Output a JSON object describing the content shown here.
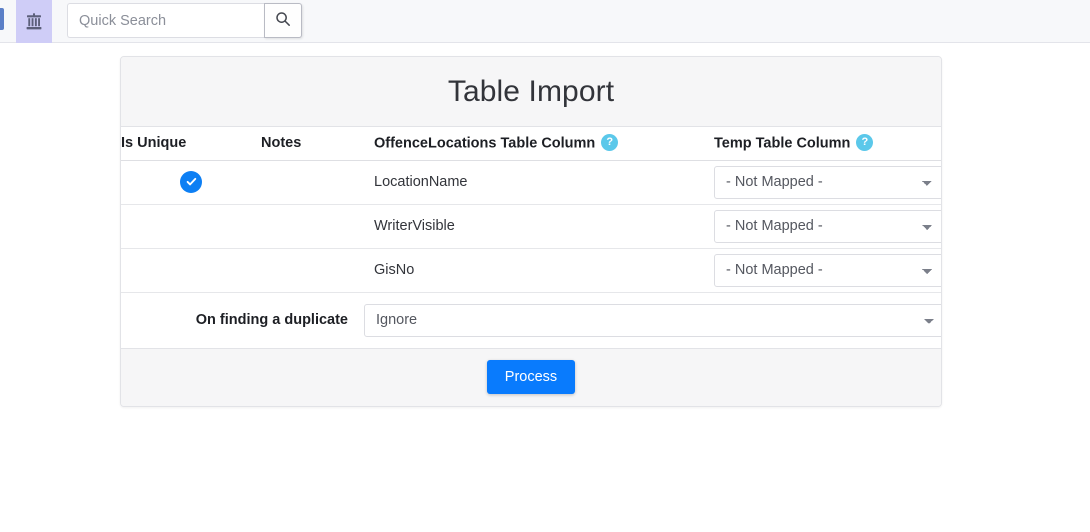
{
  "navbar": {
    "app_icon": "bank-building-icon",
    "search": {
      "placeholder": "Quick Search",
      "value": "",
      "button_icon": "search-icon"
    }
  },
  "card": {
    "title": "Table Import",
    "table": {
      "headers": {
        "is_unique": "Is Unique",
        "notes": "Notes",
        "source_column": "OffenceLocations Table Column",
        "target_column": "Temp Table Column",
        "help_glyph": "?"
      },
      "rows": [
        {
          "is_unique": true,
          "unique_icon": "check-icon",
          "notes": "",
          "source_column": "LocationName",
          "target_select": "- Not Mapped -",
          "target_options": [
            "- Not Mapped -"
          ]
        },
        {
          "is_unique": false,
          "unique_icon": "",
          "notes": "",
          "source_column": "WriterVisible",
          "target_select": "- Not Mapped -",
          "target_options": [
            "- Not Mapped -"
          ]
        },
        {
          "is_unique": false,
          "unique_icon": "",
          "notes": "",
          "source_column": "GisNo",
          "target_select": "- Not Mapped -",
          "target_options": [
            "- Not Mapped -"
          ]
        }
      ],
      "duplicate_row": {
        "label": "On finding a duplicate",
        "value": "Ignore",
        "options": [
          "Ignore"
        ]
      }
    },
    "footer": {
      "process_label": "Process"
    }
  },
  "colors": {
    "accent_blue": "#097bfd",
    "help_badge": "#5bc8ea",
    "check_badge": "#0d7ff4",
    "nav_tile": "#cfcdf7",
    "panel_gray": "#f6f6f7"
  }
}
